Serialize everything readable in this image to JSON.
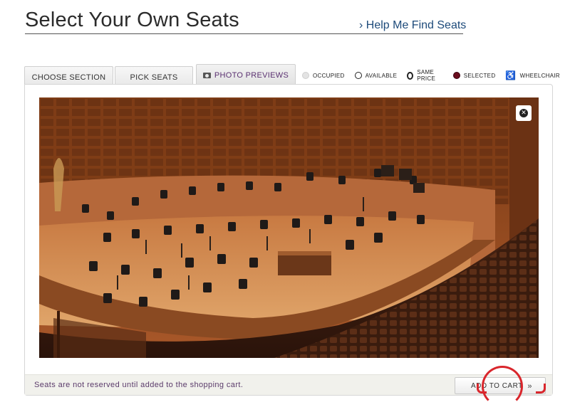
{
  "header": {
    "title": "Select Your Own Seats",
    "help_link": "› Help Me Find Seats"
  },
  "tabs": [
    {
      "label": "CHOOSE SECTION"
    },
    {
      "label": "PICK SEATS"
    },
    {
      "label": "PHOTO PREVIEWS",
      "icon": "camera-icon",
      "active": true
    }
  ],
  "legend": {
    "occupied": "OCCUPIED",
    "available": "AVAILABLE",
    "same_price": "SAME PRICE",
    "selected": "SELECTED",
    "wheelchair": "WHEELCHAIR"
  },
  "photo": {
    "close_icon": "close-icon"
  },
  "footer": {
    "note": "Seats are not reserved until added to the shopping cart.",
    "cart_button": "ADD TO CART",
    "cart_chevron": "»"
  },
  "colors": {
    "accent_link": "#1d4a7a",
    "selected": "#6a0e1e",
    "annotation": "#d9262c"
  }
}
